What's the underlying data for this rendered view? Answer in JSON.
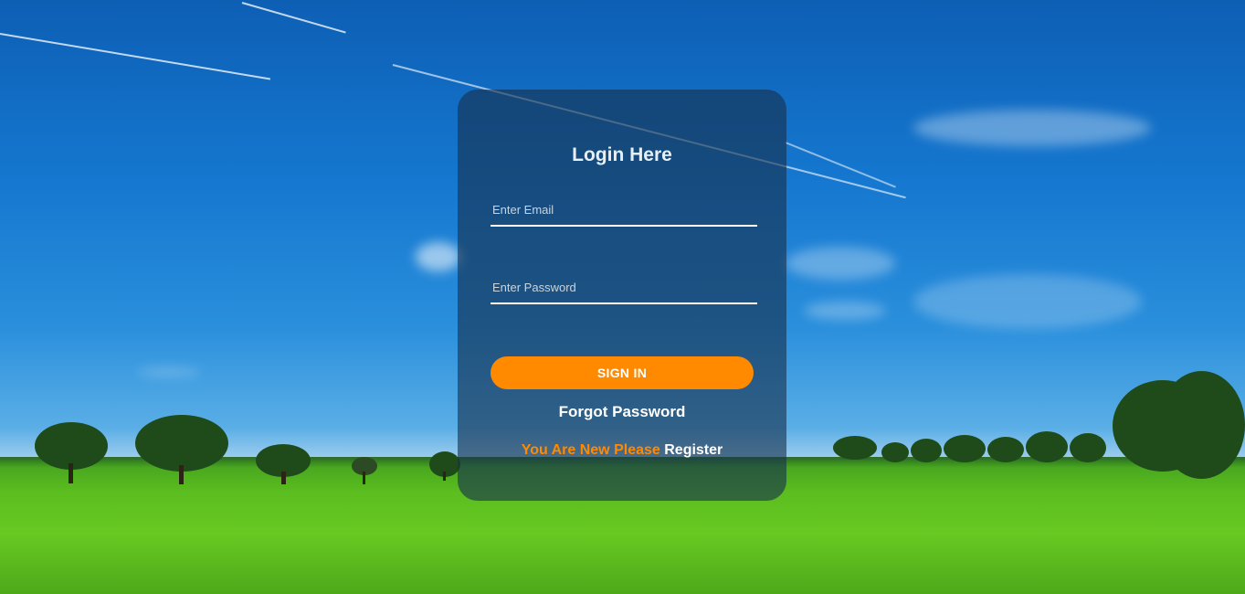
{
  "login": {
    "title": "Login Here",
    "email_placeholder": "Enter Email",
    "email_value": "",
    "password_placeholder": "Enter Password",
    "password_value": "",
    "signin_label": "SIGN IN",
    "forgot_label": "Forgot Password",
    "register_prompt": "You Are New Please",
    "register_label": "Register"
  },
  "colors": {
    "accent": "#ff8a00",
    "card_background": "#16304e",
    "text": "#ffffff"
  }
}
